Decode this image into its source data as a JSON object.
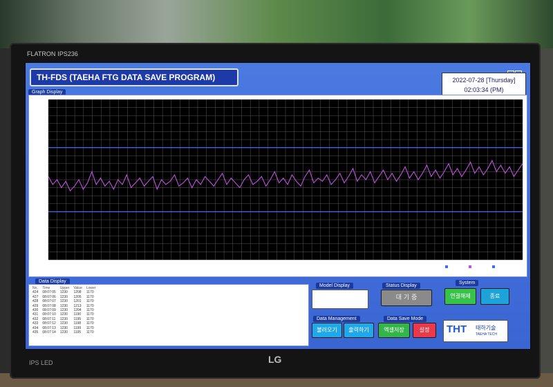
{
  "monitor": {
    "brand": "FLATRON",
    "model": "IPS236",
    "panel_label": "IPS LED",
    "maker_logo": "LG"
  },
  "app": {
    "title": "TH-FDS (TAEHA FTG DATA SAVE PROGRAM)",
    "date_line": "2022-07-28 [Thursday]",
    "time_line": "02:03:34 (PM)"
  },
  "graph": {
    "label": "Graph Display"
  },
  "chart_data": {
    "type": "line",
    "grid": true,
    "background": "#000000",
    "limit_color": "#3d6bff",
    "series_color": "#c050e0",
    "ylim": [
      0,
      100
    ],
    "upper_limit": 70,
    "lower_limit": 30,
    "series": [
      {
        "values": [
          52,
          47,
          50,
          45,
          49,
          43,
          46,
          50,
          44,
          48,
          55,
          47,
          51,
          46,
          49,
          44,
          50,
          47,
          53,
          45,
          48,
          51,
          46,
          49,
          52,
          44,
          50,
          47,
          49,
          53,
          46,
          48,
          51,
          45,
          50,
          47,
          52,
          49,
          46,
          50,
          54,
          47,
          51,
          48,
          45,
          50,
          53,
          47,
          49,
          52,
          46,
          50,
          55,
          48,
          51,
          47,
          53,
          49,
          46,
          52,
          56,
          48,
          51,
          49,
          53,
          47,
          50,
          54,
          48,
          52,
          57,
          49,
          53,
          50,
          55,
          48,
          52,
          56,
          50,
          54,
          49,
          53,
          58,
          51,
          55,
          50,
          54,
          59,
          52,
          56,
          51,
          55,
          60,
          53,
          57,
          52,
          56,
          61,
          54,
          58,
          53,
          57,
          62,
          55,
          59,
          54,
          58,
          52,
          56,
          60
        ]
      }
    ]
  },
  "data_display": {
    "label": "Data Display",
    "headers": [
      "No.",
      "Time",
      "Upper",
      "Value",
      "Lower"
    ],
    "rows": [
      [
        "424",
        "08:07:05",
        "1230",
        "1208",
        "1170"
      ],
      [
        "427",
        "08:07:06",
        "1230",
        "1205",
        "1170"
      ],
      [
        "428",
        "08:07:07",
        "1230",
        "1201",
        "1170"
      ],
      [
        "429",
        "08:07:08",
        "1230",
        "1213",
        "1170"
      ],
      [
        "430",
        "08:07:09",
        "1230",
        "1204",
        "1170"
      ],
      [
        "431",
        "08:07:10",
        "1230",
        "1190",
        "1170"
      ],
      [
        "432",
        "08:07:11",
        "1230",
        "1195",
        "1170"
      ],
      [
        "433",
        "08:07:12",
        "1230",
        "1198",
        "1170"
      ],
      [
        "434",
        "08:07:13",
        "1230",
        "1199",
        "1170"
      ],
      [
        "435",
        "08:07:14",
        "1230",
        "1195",
        "1170"
      ]
    ]
  },
  "model_display": {
    "label": "Model Display"
  },
  "status_display": {
    "label": "Status Display",
    "status": "대 기 중"
  },
  "system": {
    "label": "System",
    "connect_release": "연결해제",
    "exit": "종료"
  },
  "data_management": {
    "label": "Data Management",
    "load": "불러오기",
    "print": "출력하기"
  },
  "data_save_mode": {
    "label": "Data Save Mode",
    "excel_save": "엑셀저장",
    "settings": "설정"
  },
  "company_logo": {
    "name": "태하기술",
    "sub": "TAEHA TECH"
  }
}
